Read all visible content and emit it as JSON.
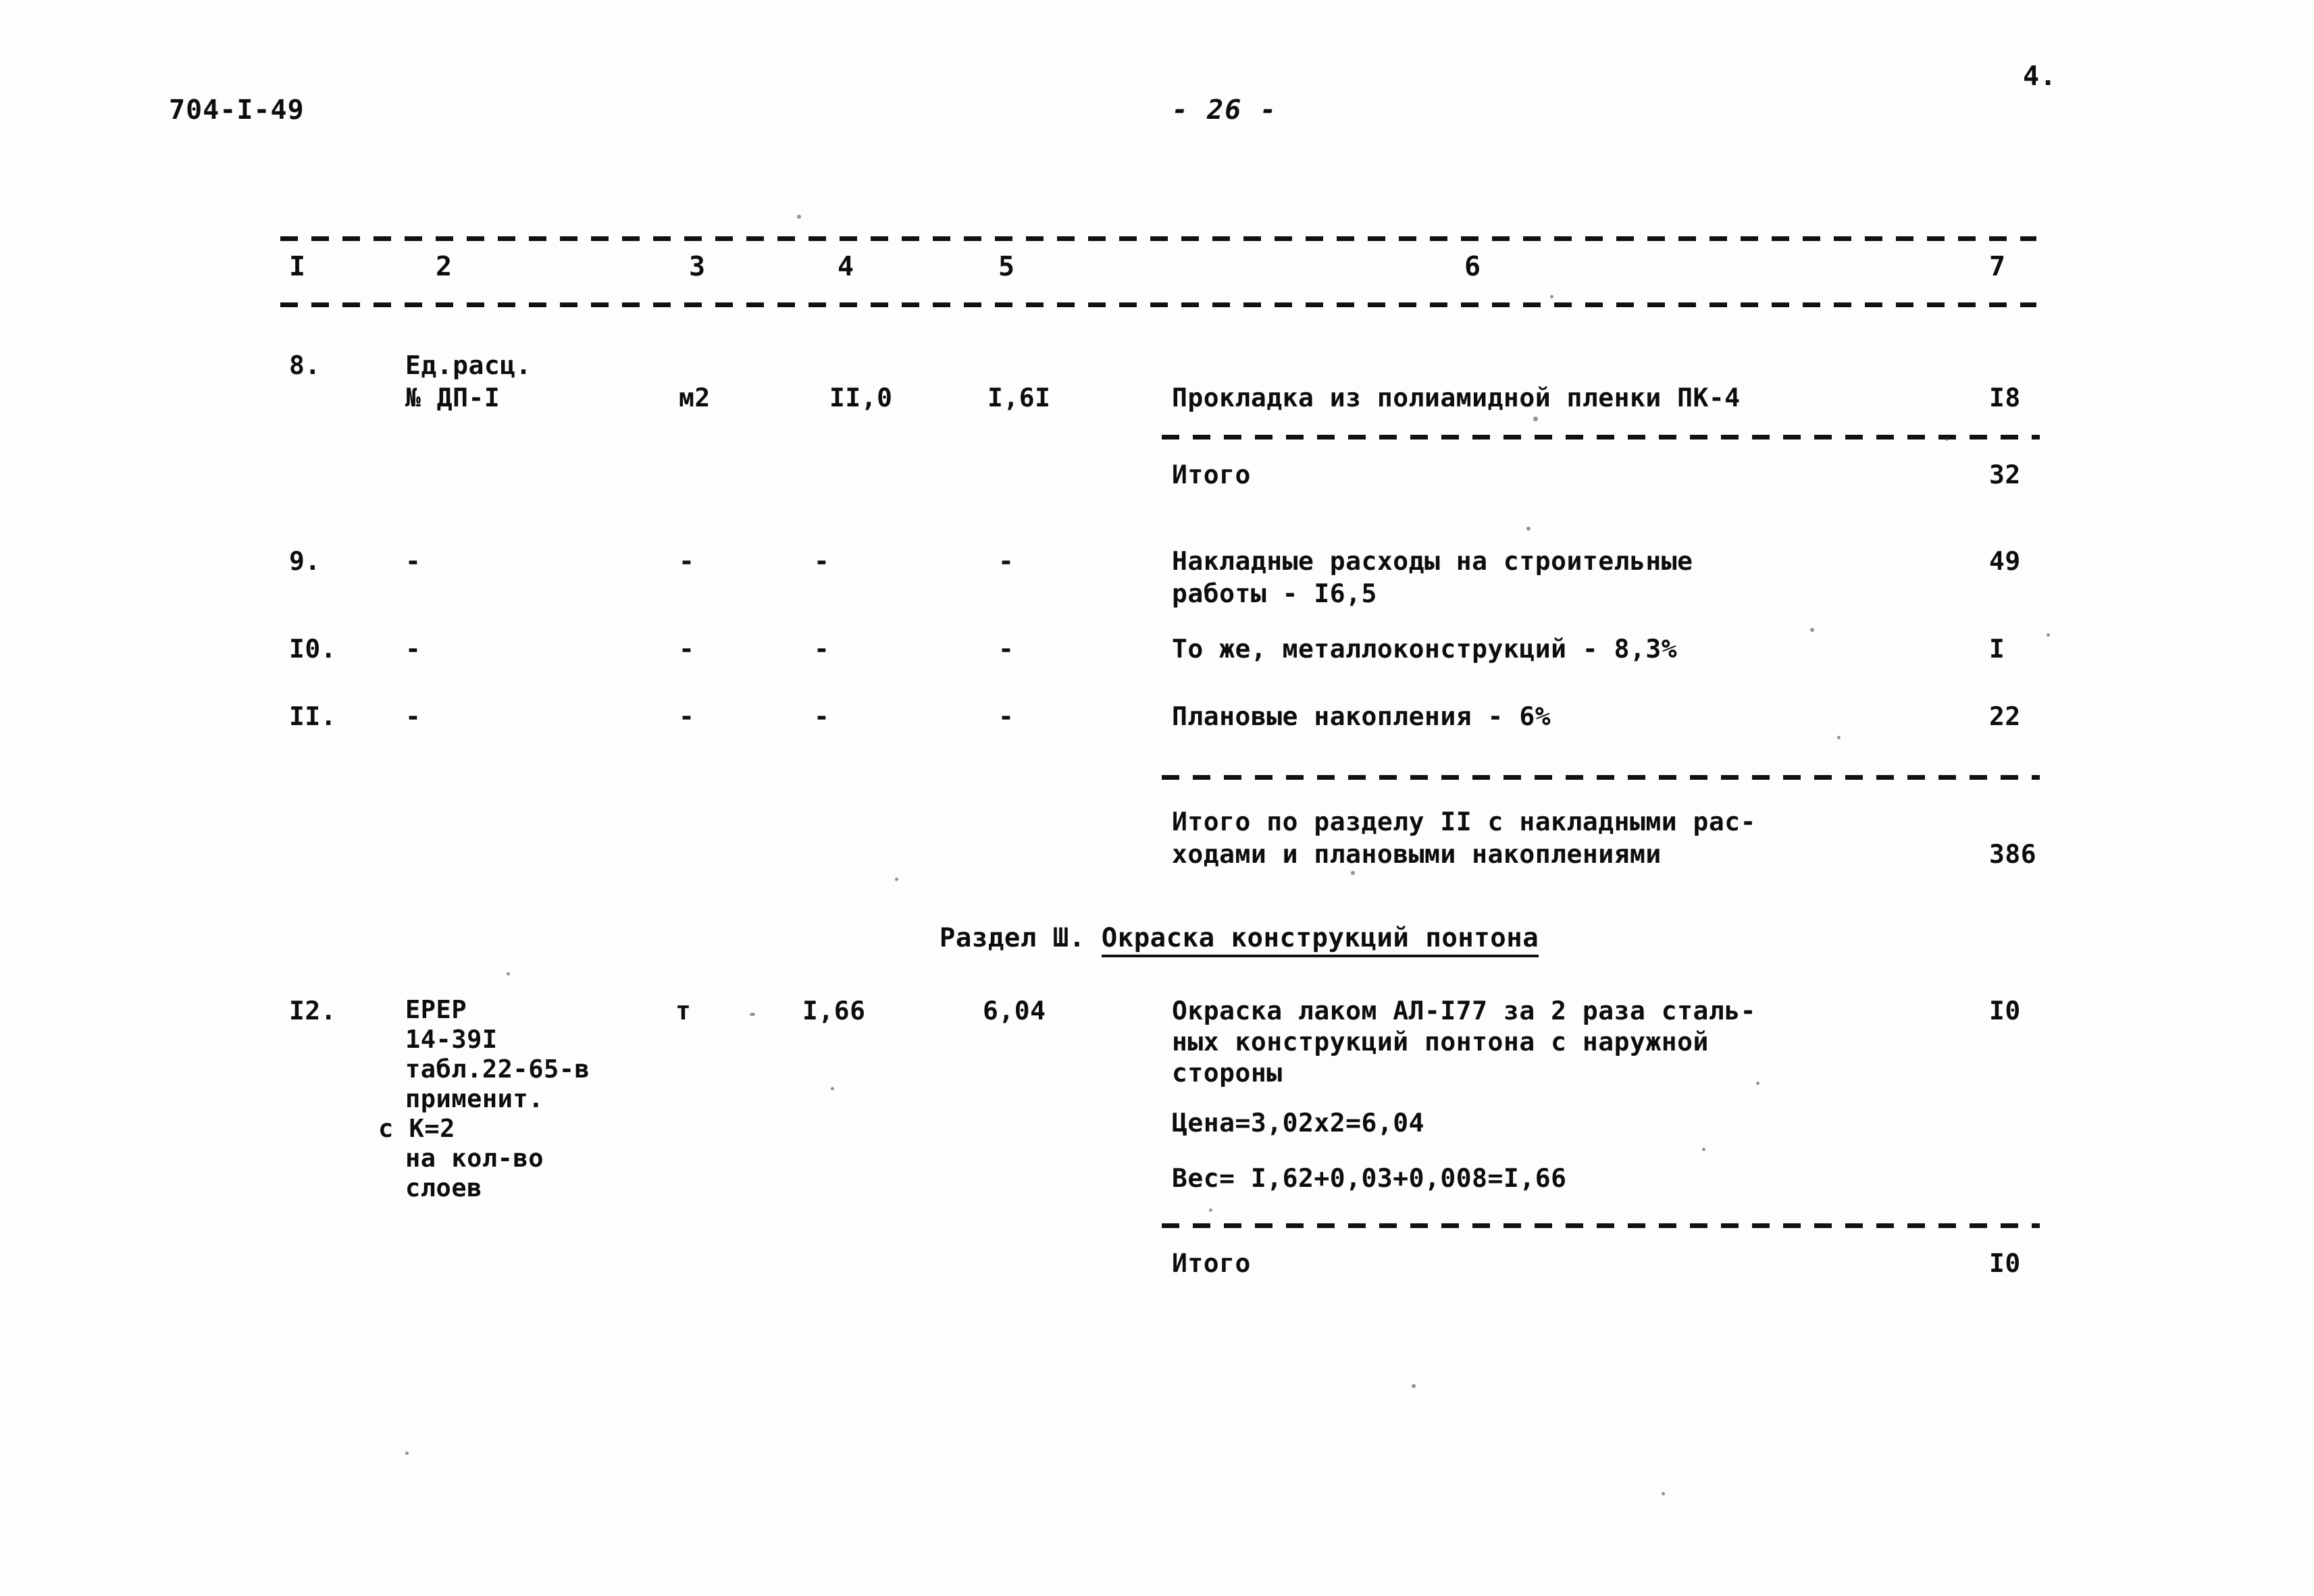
{
  "document": {
    "code": "704-I-49",
    "page_label": "- 26 -",
    "corner_number": "4."
  },
  "table": {
    "column_headers": [
      "I",
      "2",
      "3",
      "4",
      "5",
      "6",
      "7"
    ],
    "rows": [
      {
        "num": "8.",
        "justification": [
          "Ед.расц.",
          "№ ДП-I"
        ],
        "unit": "м2",
        "qty": "II,0",
        "price": "I,6I",
        "description": [
          "Прокладка из полиамидной пленки ПК-4"
        ],
        "total": "I8"
      },
      {
        "num": "",
        "justification": [],
        "unit": "",
        "qty": "",
        "price": "",
        "description": [
          "Итого"
        ],
        "total": "32"
      },
      {
        "num": "9.",
        "justification": [
          "-"
        ],
        "unit": "-",
        "qty": "-",
        "price": "-",
        "description": [
          "Накладные расходы на строительные",
          "работы - I6,5"
        ],
        "total": "49"
      },
      {
        "num": "I0.",
        "justification": [
          "-"
        ],
        "unit": "-",
        "qty": "-",
        "price": "-",
        "description": [
          "То же, металлоконструкций - 8,3%"
        ],
        "total": "I"
      },
      {
        "num": "II.",
        "justification": [
          "-"
        ],
        "unit": "-",
        "qty": "-",
        "price": "-",
        "description": [
          "Плановые накопления - 6%"
        ],
        "total": "22"
      },
      {
        "num": "",
        "justification": [],
        "unit": "",
        "qty": "",
        "price": "",
        "description": [
          "Итого по разделу II с накладными рас-",
          "ходами и плановыми накоплениями"
        ],
        "total": "386"
      },
      {
        "num": "I2.",
        "justification": [
          "ЕРЕР",
          "14-39I",
          "табл.22-65-в",
          "применит.",
          "с К=2",
          "на кол-во",
          "слоев"
        ],
        "unit": "т",
        "qty": "I,66",
        "price": "6,04",
        "description": [
          "Окраска лаком АЛ-I77 за 2 раза сталь-",
          "ных конструкций понтона с наружной",
          "стороны"
        ],
        "notes": [
          "Цена=3,02х2=6,04",
          "Вес= I,62+0,03+0,008=I,66"
        ],
        "total": "I0"
      },
      {
        "num": "",
        "justification": [],
        "unit": "",
        "qty": "",
        "price": "",
        "description": [
          "Итого"
        ],
        "total": "I0"
      }
    ],
    "section_heading": {
      "prefix": "Раздел Ш.",
      "title": "Окраска конструкций понтона"
    }
  }
}
